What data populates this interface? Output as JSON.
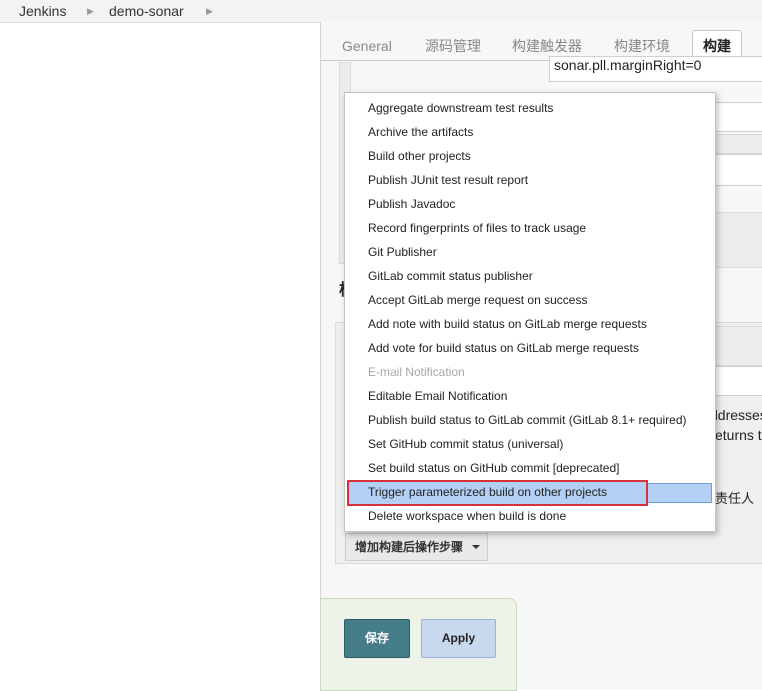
{
  "breadcrumb": {
    "items": [
      "Jenkins",
      "demo-sonar"
    ]
  },
  "tabs": [
    {
      "label": "General"
    },
    {
      "label": "源码管理"
    },
    {
      "label": "构建触发器"
    },
    {
      "label": "构建环境"
    },
    {
      "label": "构建"
    }
  ],
  "background": {
    "sonar_field_value": "sonar.pll.marginRight=0",
    "section_fragment": "构",
    "text_fragment_1": "ddresses",
    "text_fragment_2": "eturns t",
    "text_fragment_3": "责任人"
  },
  "dropdown": {
    "items": [
      {
        "label": "Aggregate downstream test results",
        "disabled": false
      },
      {
        "label": "Archive the artifacts",
        "disabled": false
      },
      {
        "label": "Build other projects",
        "disabled": false
      },
      {
        "label": "Publish JUnit test result report",
        "disabled": false
      },
      {
        "label": "Publish Javadoc",
        "disabled": false
      },
      {
        "label": "Record fingerprints of files to track usage",
        "disabled": false
      },
      {
        "label": "Git Publisher",
        "disabled": false
      },
      {
        "label": "GitLab commit status publisher",
        "disabled": false
      },
      {
        "label": "Accept GitLab merge request on success",
        "disabled": false
      },
      {
        "label": "Add note with build status on GitLab merge requests",
        "disabled": false
      },
      {
        "label": "Add vote for build status on GitLab merge requests",
        "disabled": false
      },
      {
        "label": "E-mail Notification",
        "disabled": true
      },
      {
        "label": "Editable Email Notification",
        "disabled": false
      },
      {
        "label": "Publish build status to GitLab commit (GitLab 8.1+ required)",
        "disabled": false
      },
      {
        "label": "Set GitHub commit status (universal)",
        "disabled": false
      },
      {
        "label": "Set build status on GitHub commit [deprecated]",
        "disabled": false
      },
      {
        "label": "Trigger parameterized build on other projects",
        "disabled": false,
        "highlighted": true
      },
      {
        "label": "Delete workspace when build is done",
        "disabled": false
      }
    ]
  },
  "add_post_build_button": {
    "label": "增加构建后操作步骤"
  },
  "actions": {
    "save_label": "保存",
    "apply_label": "Apply"
  },
  "colors": {
    "save_button": "#467d8a",
    "apply_button": "#c8d9ee",
    "highlight": "#b3cff3",
    "annotation_box": "#d9313a"
  }
}
